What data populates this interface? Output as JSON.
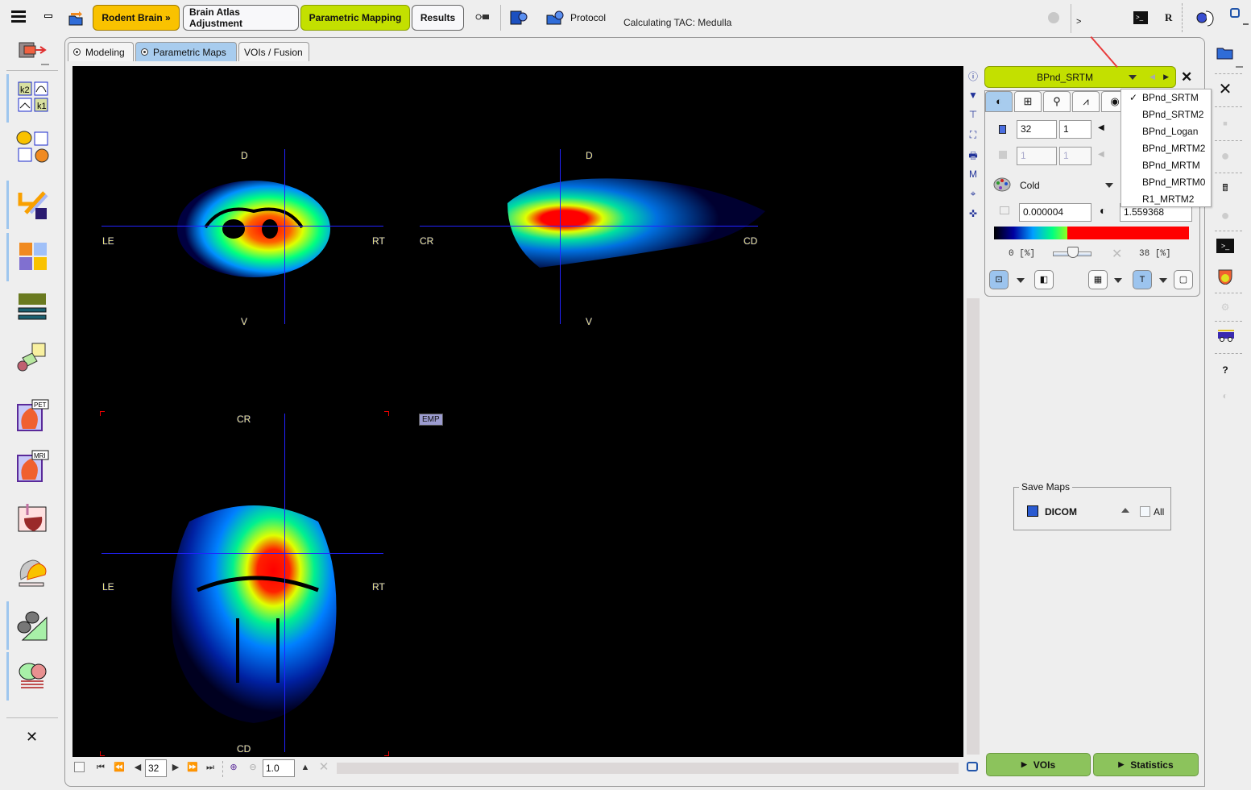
{
  "toolbar": {
    "steps": [
      {
        "label": "Rodent Brain »",
        "state": "current"
      },
      {
        "label": "Brain Atlas Adjustment",
        "state": "normal"
      },
      {
        "label": "Parametric Mapping",
        "state": "active"
      },
      {
        "label": "Results",
        "state": "normal"
      }
    ],
    "protocol_label": "Protocol",
    "status_text": "Calculating TAC: Medulla",
    "console_prompt": ">",
    "r_label": "R"
  },
  "tabs": [
    {
      "label": "Modeling",
      "active": false
    },
    {
      "label": "Parametric Maps",
      "active": true
    },
    {
      "label": "VOIs / Fusion",
      "active": false
    }
  ],
  "viewer": {
    "coronal": {
      "top": "D",
      "bottom": "V",
      "left": "LE",
      "right": "RT"
    },
    "sagittal": {
      "top": "D",
      "bottom": "V",
      "left": "CR",
      "right": "CD"
    },
    "axial": {
      "top": "CR",
      "bottom": "CD",
      "left": "LE",
      "right": "RT"
    },
    "emp_badge": "EMP"
  },
  "navigation": {
    "slice": "32",
    "zoom": "1.0"
  },
  "map_panel": {
    "selected_map": "BPnd_SRTM",
    "map_options": [
      {
        "label": "BPnd_SRTM",
        "checked": true
      },
      {
        "label": "BPnd_SRTM2",
        "checked": false
      },
      {
        "label": "BPnd_Logan",
        "checked": false
      },
      {
        "label": "BPnd_MRTM2",
        "checked": false
      },
      {
        "label": "BPnd_MRTM",
        "checked": false
      },
      {
        "label": "BPnd_MRTM0",
        "checked": false
      },
      {
        "label": "R1_MRTM2",
        "checked": false
      }
    ],
    "slice_value": "32",
    "frame_value": "1",
    "disabled_value_1": "1",
    "disabled_value_2": "1",
    "colortable": "Cold",
    "min_value": "0.000004",
    "max_value": "1.559368",
    "lower_percent": "0",
    "upper_percent": "38",
    "percent_unit": "[%]"
  },
  "save_maps": {
    "title": "Save Maps",
    "format": "DICOM",
    "all_label": "All",
    "all_checked": false
  },
  "bottom_buttons": {
    "vois": "VOIs",
    "statistics": "Statistics"
  }
}
